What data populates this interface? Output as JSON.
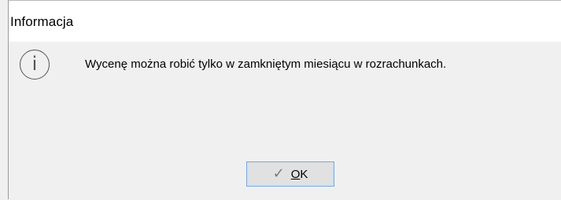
{
  "dialog": {
    "title": "Informacja",
    "icon": "info-icon",
    "icon_glyph": "i",
    "message": "Wycenę można robić tylko w zamkniętym miesiącu w rozrachunkach."
  },
  "buttons": {
    "ok": {
      "icon": "check-icon",
      "icon_glyph": "✓",
      "accel": "O",
      "rest": "K"
    }
  },
  "colors": {
    "background": "#f0f0f0",
    "titlebar": "#ffffff",
    "button_border": "#7aa7d6",
    "icon": "#555555"
  }
}
